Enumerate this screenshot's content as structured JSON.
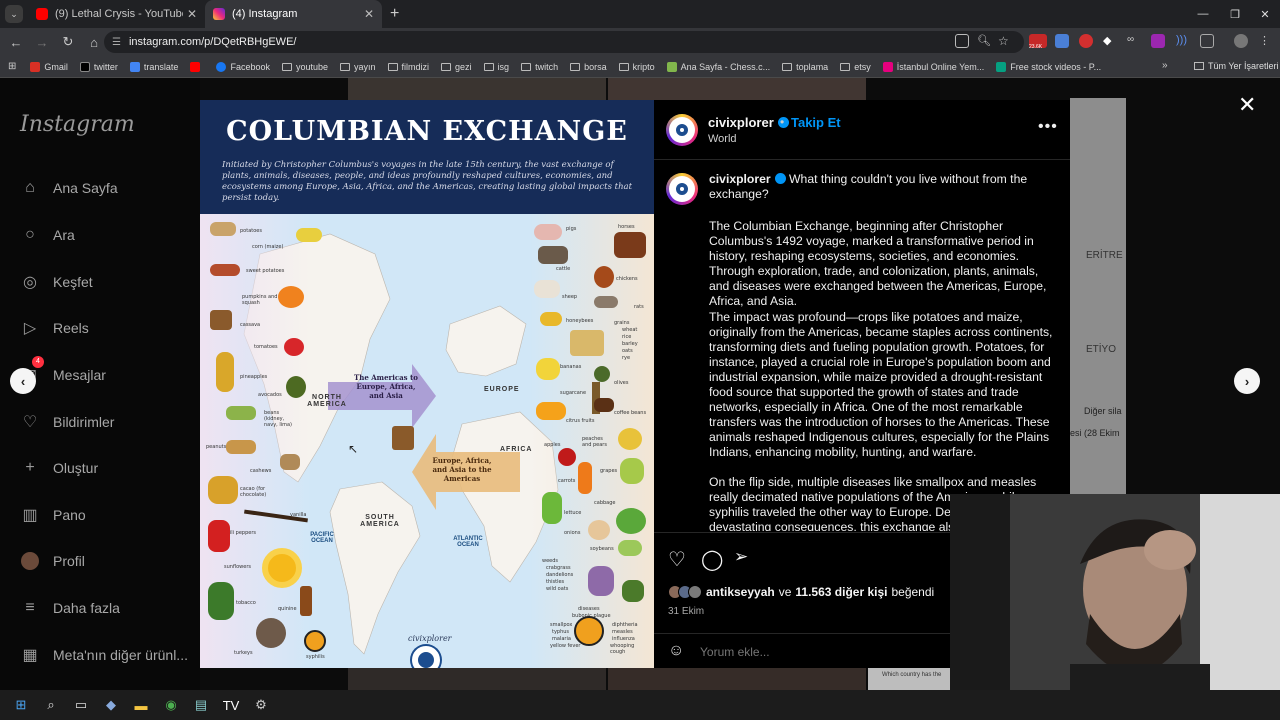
{
  "browser": {
    "tabs": [
      {
        "title": "(9) Lethal Crysis - YouTube",
        "active": false,
        "favicon_color": "#ff0000"
      },
      {
        "title": "(4) Instagram",
        "active": true,
        "favicon_color": "#e1306c"
      }
    ],
    "new_tab": "+",
    "url": "instagram.com/p/DQetRBHgEWE/",
    "bookmarks": [
      "Gmail",
      "twitter",
      "translate",
      "",
      "Facebook",
      "youtube",
      "yayın",
      "filmdizi",
      "gezi",
      "isg",
      "twitch",
      "borsa",
      "kripto",
      "Ana Sayfa - Chess.c...",
      "toplama",
      "etsy",
      "İstanbul Online Yem...",
      "Free stock videos - P..."
    ],
    "all_bookmarks": "Tüm Yer İşaretleri",
    "ext_badge": "23.6K"
  },
  "sidebar": {
    "logo": "Instagram",
    "items": [
      {
        "label": "Ana Sayfa",
        "icon": "home-icon"
      },
      {
        "label": "Ara",
        "icon": "search-icon"
      },
      {
        "label": "Keşfet",
        "icon": "compass-icon"
      },
      {
        "label": "Reels",
        "icon": "reels-icon"
      },
      {
        "label": "Mesajlar",
        "icon": "messenger-icon",
        "badge": "4"
      },
      {
        "label": "Bildirimler",
        "icon": "heart-icon"
      },
      {
        "label": "Oluştur",
        "icon": "plus-icon"
      },
      {
        "label": "Pano",
        "icon": "dashboard-icon"
      },
      {
        "label": "Profil",
        "icon": "avatar-icon"
      },
      {
        "label": "Daha fazla",
        "icon": "menu-icon"
      },
      {
        "label": "Meta'nın diğer ürünl...",
        "icon": "meta-icon"
      }
    ]
  },
  "background": {
    "labels": [
      "ERİTRE",
      "ETİYO",
      "Diğer sila",
      "esi (28 Ekim",
      "Which country has the"
    ]
  },
  "infographic": {
    "title": "COLUMBIAN EXCHANGE",
    "subtitle": "Initiated by Christopher Columbus's voyages in the late 15th century, the vast exchange of plants, animals, diseases, people, and ideas profoundly reshaped cultures, economies, and ecosystems among Europe, Asia, Africa, and the Americas, creating lasting global impacts that persist today.",
    "regions": [
      "NORTH AMERICA",
      "EUROPE",
      "AFRICA",
      "SOUTH AMERICA",
      "PACIFIC OCEAN",
      "ATLANTIC OCEAN"
    ],
    "arrow_east": "The Americas to Europe, Africa, and Asia",
    "arrow_west": "Europe, Africa, and Asia to the Americas",
    "americas_items": [
      "potatoes",
      "corn (maize)",
      "sweet potatoes",
      "pumpkins and squash",
      "cassava",
      "tomatoes",
      "pineapples",
      "avocados",
      "beans (kidney, navy, lima)",
      "peanuts",
      "cashews",
      "cacao (for chocolate)",
      "vanilla",
      "chili peppers",
      "sunflowers",
      "tobacco",
      "quinine",
      "turkeys",
      "syphilis"
    ],
    "europe_items": [
      "pigs",
      "horses",
      "cattle",
      "chickens",
      "sheep",
      "rats",
      "honeybees",
      "grains",
      "wheat",
      "rice",
      "barley",
      "oats",
      "rye",
      "bananas",
      "olives",
      "sugarcane",
      "coffee beans",
      "citrus fruits",
      "peaches and pears",
      "apples",
      "grapes",
      "carrots",
      "cabbage",
      "lettuce",
      "onions",
      "soybeans",
      "weeds",
      "crabgrass",
      "dandelions",
      "thistles",
      "wild oats",
      "diseases",
      "bubonic plague",
      "smallpox",
      "typhus",
      "malaria",
      "yellow fever",
      "diphtheria",
      "measles",
      "influenza",
      "whooping cough"
    ],
    "brand": "civixplorer"
  },
  "post": {
    "author": "civixplorer",
    "follow_label": "Takip Et",
    "location": "World",
    "question": "What thing couldn't you live without from the exchange?",
    "paragraphs": [
      "The Columbian Exchange, beginning after Christopher Columbus's 1492 voyage, marked a transformative period in history, reshaping ecosystems, societies, and economies. Through exploration, trade, and colonization, plants, animals, and diseases were exchanged between the Americas, Europe, Africa, and Asia.",
      "The impact was profound—crops like potatoes and maize, originally from the Americas, became staples across continents, transforming diets and fueling population growth. Potatoes, for instance, played a crucial role in Europe's population boom and industrial expansion, while maize provided a drought-resistant food source that supported the growth of states and trade networks, especially in Africa. One of the most remarkable transfers was the introduction of horses to the Americas. These animals reshaped Indigenous cultures, especially for the Plains Indians, enhancing mobility, hunting, and warfare.",
      "On the flip side, multiple diseases like smallpox and measles really decimated native populations of the Americas, while syphilis traveled the other way to Europe. Despite its devastating consequences, this exchange also l"
    ],
    "liked_by": "antikseyyah",
    "liked_and": "ve",
    "liked_others": "11.563 diğer kişi",
    "liked_suffix": "beğendi",
    "date": "31 Ekim",
    "comment_placeholder": "Yorum ekle..."
  },
  "colors": {
    "accent": "#0095f6",
    "header_navy": "#162c58",
    "ig_black": "#000000"
  }
}
